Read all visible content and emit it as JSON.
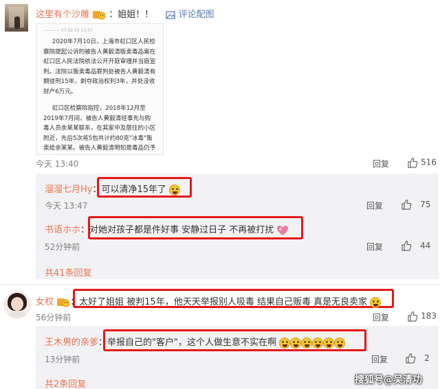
{
  "c1": {
    "name": "这里有个沙雕",
    "text": "：姐姐！！",
    "pic_link": "评论配图",
    "doc": {
      "header": "———— 07:02  02  13.07",
      "p1": "2020年7月10日，上海市虹口区人民检察院提起公诉的被告人黄毅清贩卖毒品案在虹口区人民法院依法公开开庭审理并当庭宣判。法院以贩卖毒品罪判处被告人黄毅清有期徒刑15年，剥夺政治权利3年，并处没收财产6万元。",
      "p2": "虹口区检察院指控，2018年12月至2019年7月间，被告人黄毅清经事先与购毒人员余某某联系，在其家中及居住的小区附近，先后5次将5包共计约80克\"冰毒\"贩卖给余某某。被告人黄毅清明知是毒品仍予以贩卖，其行"
    },
    "time": "今天 13:40",
    "reply": "回复",
    "likes": "516",
    "subs": [
      {
        "name": "溜溜七月Hy",
        "text": "：可以清净15年了",
        "time": "今天 13:47",
        "reply": "回复",
        "likes": "75"
      },
      {
        "name": "书语ホホ",
        "text": "：对她对孩子都是件好事 安静过日子 不再被打扰",
        "time": "52分钟前",
        "reply": "回复",
        "likes": "44"
      }
    ],
    "more": "共41条回复"
  },
  "c2": {
    "name": "女权",
    "text": "：太好了姐姐 被判15年，他天天举报别人吸毒 结果自己贩毒 真是无良卖家",
    "time": "56分钟前",
    "reply": "回复",
    "likes": "183",
    "subs": [
      {
        "name": "王木男的亲爹",
        "text": "：举报自己的\"客户\"，这个人做生意不实在啊",
        "time": "13分钟前",
        "reply": "回复",
        "likes": "2"
      }
    ],
    "more": "共2条回复"
  },
  "watermark": "搜狐号@吴清功",
  "colors": {
    "name": "#eb7350",
    "highlight": "#e61717",
    "sub_bg": "#f2f2f5"
  },
  "icons": [
    "avatar",
    "vip-emoji-icon",
    "image-icon",
    "thumb-up-icon",
    "laugh-emoji-icon",
    "heart-emoji-icon",
    "grin-emoji-icon"
  ]
}
